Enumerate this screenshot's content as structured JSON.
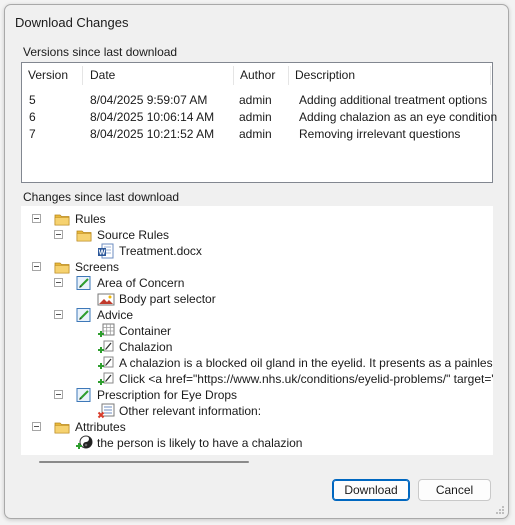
{
  "window": {
    "title": "Download Changes"
  },
  "versions": {
    "section_label": "Versions since last download",
    "columns": [
      "Version",
      "Date",
      "Author",
      "Description"
    ],
    "rows": [
      [
        "5",
        "8/04/2025 9:59:07 AM",
        "admin",
        "Adding additional treatment options"
      ],
      [
        "6",
        "8/04/2025 10:06:14 AM",
        "admin",
        "Adding chalazion as an eye condition"
      ],
      [
        "7",
        "8/04/2025 10:21:52 AM",
        "admin",
        "Removing irrelevant questions"
      ]
    ]
  },
  "changes": {
    "section_label": "Changes since last download",
    "nodes": [
      {
        "label": "Rules",
        "icon": "folder-icon",
        "level": 0,
        "expander": true
      },
      {
        "label": "Source Rules",
        "icon": "folder-icon",
        "level": 1,
        "expander": true
      },
      {
        "label": "Treatment.docx",
        "icon": "word-document-icon",
        "level": 2,
        "expander": false
      },
      {
        "label": "Screens",
        "icon": "folder-icon",
        "level": 0,
        "expander": true
      },
      {
        "label": "Area of Concern",
        "icon": "screen-edit-icon",
        "level": 1,
        "expander": true
      },
      {
        "label": "Body part selector",
        "icon": "image-control-icon",
        "level": 2,
        "expander": false
      },
      {
        "label": "Advice",
        "icon": "screen-edit-icon",
        "level": 1,
        "expander": true
      },
      {
        "label": "Container",
        "icon": "add-container-icon",
        "level": 2,
        "expander": false
      },
      {
        "label": "Chalazion",
        "icon": "add-label-icon",
        "level": 2,
        "expander": false
      },
      {
        "label": "A chalazion is a blocked oil gland in the eyelid. It presents as a painless, slow-gro",
        "icon": "add-label-icon",
        "level": 2,
        "expander": false
      },
      {
        "label": "Click <a href=\"https://www.nhs.uk/conditions/eyelid-problems/\" target=\"_blank",
        "icon": "add-label-icon",
        "level": 2,
        "expander": false
      },
      {
        "label": "Prescription for Eye Drops",
        "icon": "screen-edit-icon",
        "level": 1,
        "expander": true
      },
      {
        "label": "Other relevant information:",
        "icon": "delete-list-icon",
        "level": 2,
        "expander": false
      },
      {
        "label": "Attributes",
        "icon": "folder-icon",
        "level": 0,
        "expander": true
      },
      {
        "label": "the person is likely to have a chalazion",
        "icon": "add-attribute-icon",
        "level": 1,
        "expander": false
      }
    ]
  },
  "buttons": {
    "download": "Download",
    "cancel": "Cancel"
  },
  "colors": {
    "accent": "#0067c0",
    "folder": "#e8b83a",
    "add": "#2e9e2e",
    "delete": "#d83b2a"
  }
}
